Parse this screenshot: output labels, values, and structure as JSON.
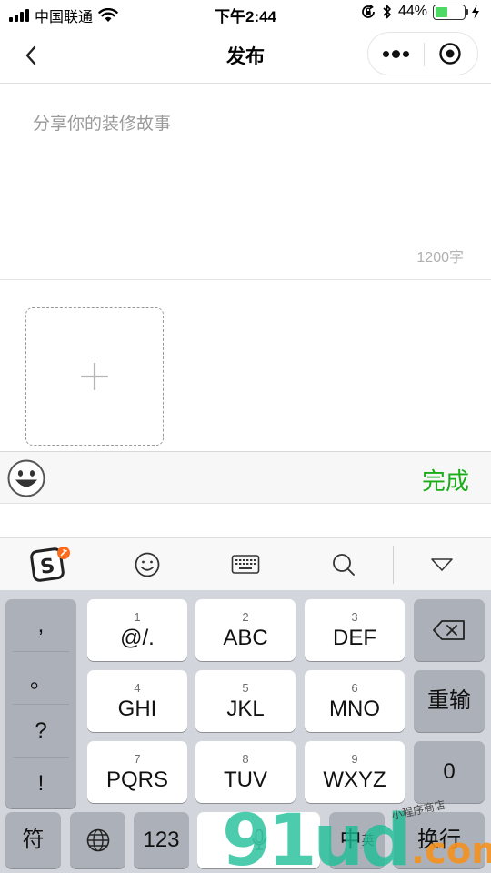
{
  "status_bar": {
    "carrier": "中国联通",
    "time": "下午2:44",
    "battery_percent": "44%",
    "battery_level": 0.44
  },
  "nav": {
    "title": "发布"
  },
  "editor": {
    "placeholder": "分享你的装修故事",
    "value": "",
    "char_limit": "1200字"
  },
  "upload": {
    "add_icon": "plus-icon"
  },
  "done_bar": {
    "done_label": "完成",
    "color": "#1aad19"
  },
  "keyboard": {
    "punctuation": [
      ",",
      "。",
      "?",
      "!"
    ],
    "keys_row1": [
      {
        "num": "1",
        "label": "@/."
      },
      {
        "num": "2",
        "label": "ABC"
      },
      {
        "num": "3",
        "label": "DEF"
      }
    ],
    "keys_row2": [
      {
        "num": "4",
        "label": "GHI"
      },
      {
        "num": "5",
        "label": "JKL"
      },
      {
        "num": "6",
        "label": "MNO"
      }
    ],
    "keys_row3": [
      {
        "num": "7",
        "label": "PQRS"
      },
      {
        "num": "8",
        "label": "TUV"
      },
      {
        "num": "9",
        "label": "WXYZ"
      }
    ],
    "retype_label": "重输",
    "zero_label": "0",
    "symbol_label": "符",
    "numbers_label": "123",
    "zh_label": "中",
    "en_label": "英",
    "return_label": "换行"
  },
  "watermark": {
    "green": "91ud",
    "orange": ".com",
    "tag": "小程序商店"
  }
}
